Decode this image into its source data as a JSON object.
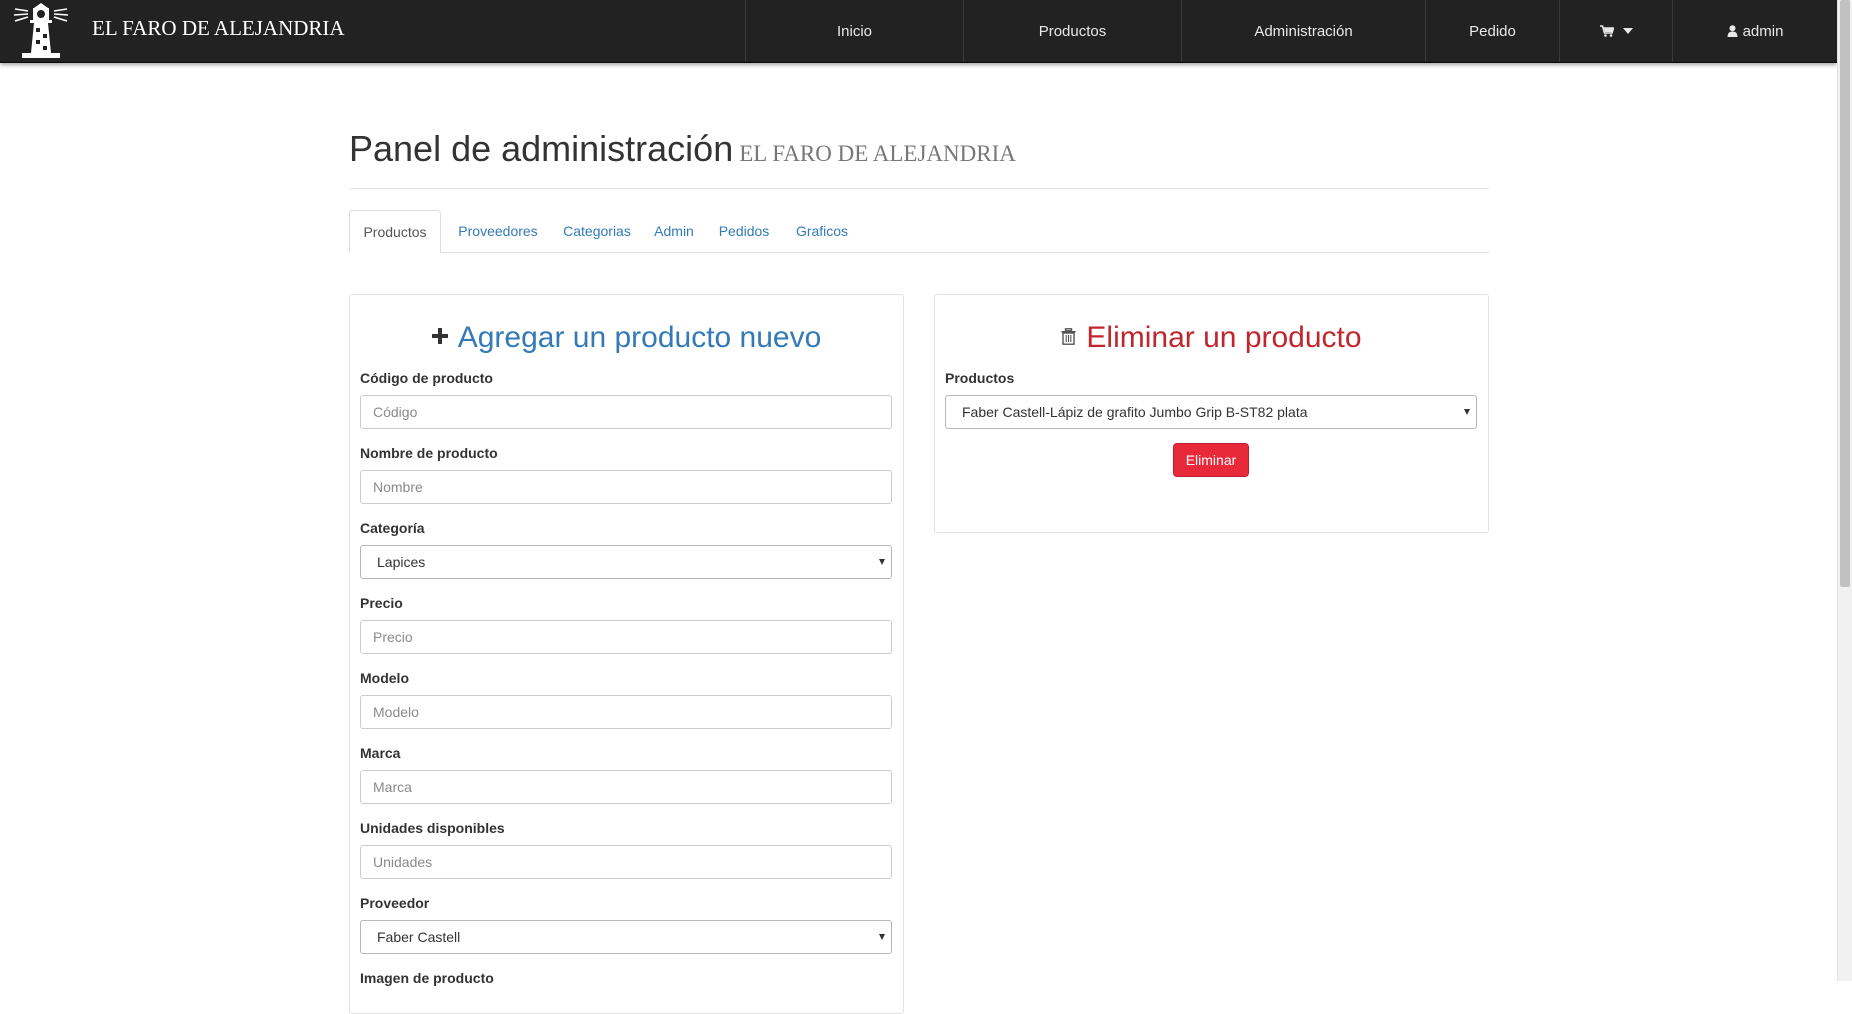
{
  "navbar": {
    "brand": "EL FARO DE ALEJANDRIA",
    "items": [
      {
        "label": "Inicio"
      },
      {
        "label": "Productos"
      },
      {
        "label": "Administración"
      },
      {
        "label": "Pedido"
      },
      {
        "label": "",
        "icon": "shopping-cart-icon"
      },
      {
        "label": "admin",
        "icon": "user-icon"
      }
    ]
  },
  "header": {
    "title": "Panel de administración",
    "subtitle": "EL FARO DE ALEJANDRIA"
  },
  "tabs": [
    {
      "label": "Productos",
      "active": true
    },
    {
      "label": "Proveedores"
    },
    {
      "label": "Categorias"
    },
    {
      "label": "Admin"
    },
    {
      "label": "Pedidos"
    },
    {
      "label": "Graficos"
    }
  ],
  "add_product": {
    "heading": "Agregar un producto nuevo",
    "icon": "plus-icon",
    "fields": {
      "codigo": {
        "label": "Código de producto",
        "placeholder": "Código"
      },
      "nombre": {
        "label": "Nombre de producto",
        "placeholder": "Nombre"
      },
      "categoria": {
        "label": "Categoría",
        "value": "Lapices"
      },
      "precio": {
        "label": "Precio",
        "placeholder": "Precio"
      },
      "modelo": {
        "label": "Modelo",
        "placeholder": "Modelo"
      },
      "marca": {
        "label": "Marca",
        "placeholder": "Marca"
      },
      "unidades": {
        "label": "Unidades disponibles",
        "placeholder": "Unidades"
      },
      "proveedor": {
        "label": "Proveedor",
        "value": "Faber Castell"
      },
      "imagen": {
        "label": "Imagen de producto"
      }
    }
  },
  "delete_product": {
    "heading": "Eliminar un producto",
    "icon": "trash-icon",
    "productos_label": "Productos",
    "productos_value": "Faber Castell-Lápiz de grafito Jumbo Grip B-ST82 plata",
    "button": "Eliminar"
  },
  "colors": {
    "navbar_bg": "#222222",
    "link": "#337ab7",
    "danger_heading": "#c0262d",
    "danger_button": "#e8293a"
  }
}
